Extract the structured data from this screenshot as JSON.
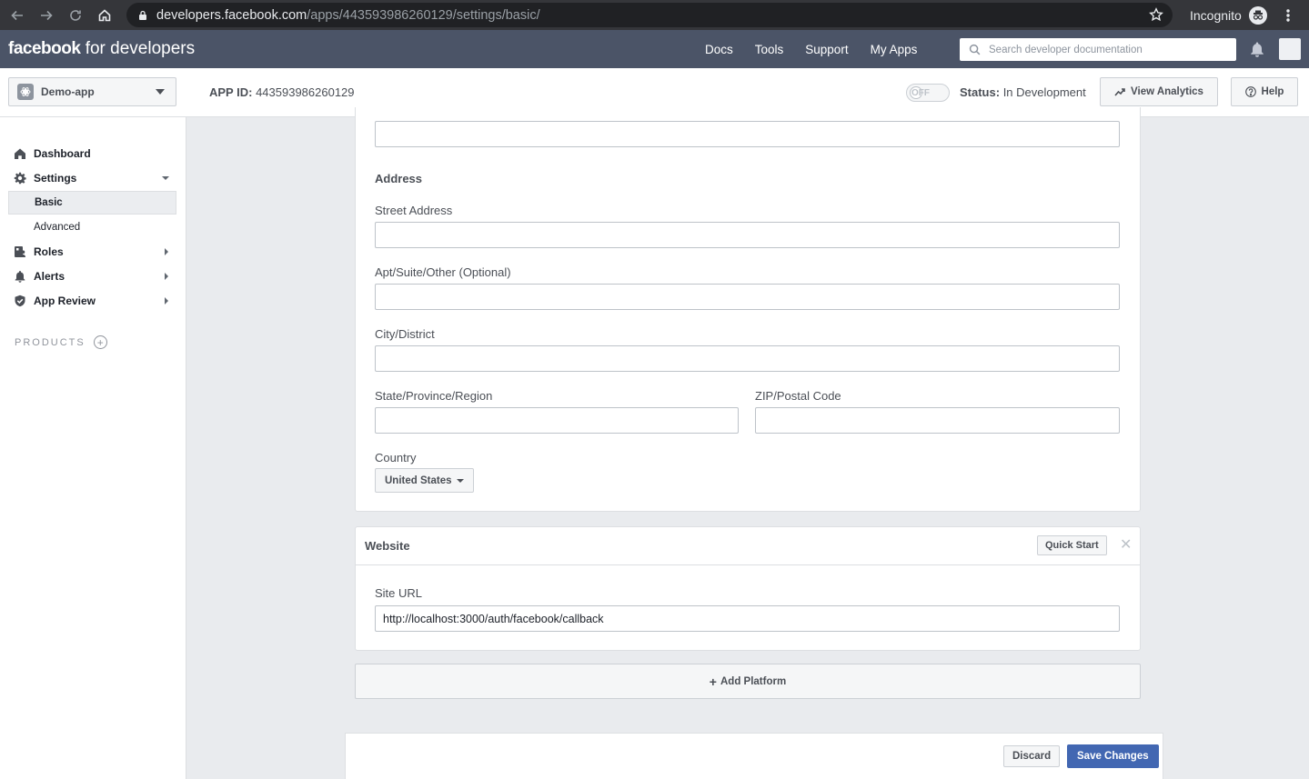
{
  "browser": {
    "url_host": "developers.facebook.com",
    "url_path": "/apps/443593986260129/settings/basic/",
    "incognito_label": "Incognito"
  },
  "header": {
    "brand_bold": "facebook",
    "brand_rest": " for developers",
    "nav": [
      "Docs",
      "Tools",
      "Support",
      "My Apps"
    ],
    "search_placeholder": "Search developer documentation"
  },
  "appbar": {
    "app_name": "Demo-app",
    "app_id_label": "APP ID:",
    "app_id_value": "443593986260129",
    "toggle_label": "OFF",
    "status_label": "Status:",
    "status_value": "In Development",
    "analytics_label": "View Analytics",
    "help_label": "Help"
  },
  "sidebar": {
    "dashboard": "Dashboard",
    "settings": "Settings",
    "basic": "Basic",
    "advanced": "Advanced",
    "roles": "Roles",
    "alerts": "Alerts",
    "app_review": "App Review",
    "products": "PRODUCTS"
  },
  "address": {
    "title": "Address",
    "street_label": "Street Address",
    "street_value": "",
    "apt_label": "Apt/Suite/Other (Optional)",
    "apt_value": "",
    "city_label": "City/District",
    "city_value": "",
    "state_label": "State/Province/Region",
    "state_value": "",
    "zip_label": "ZIP/Postal Code",
    "zip_value": "",
    "country_label": "Country",
    "country_value": "United States"
  },
  "website": {
    "title": "Website",
    "quick_start": "Quick Start",
    "site_url_label": "Site URL",
    "site_url_value": "http://localhost:3000/auth/facebook/callback"
  },
  "actions": {
    "add_platform": "Add Platform",
    "discard": "Discard",
    "save": "Save Changes"
  }
}
